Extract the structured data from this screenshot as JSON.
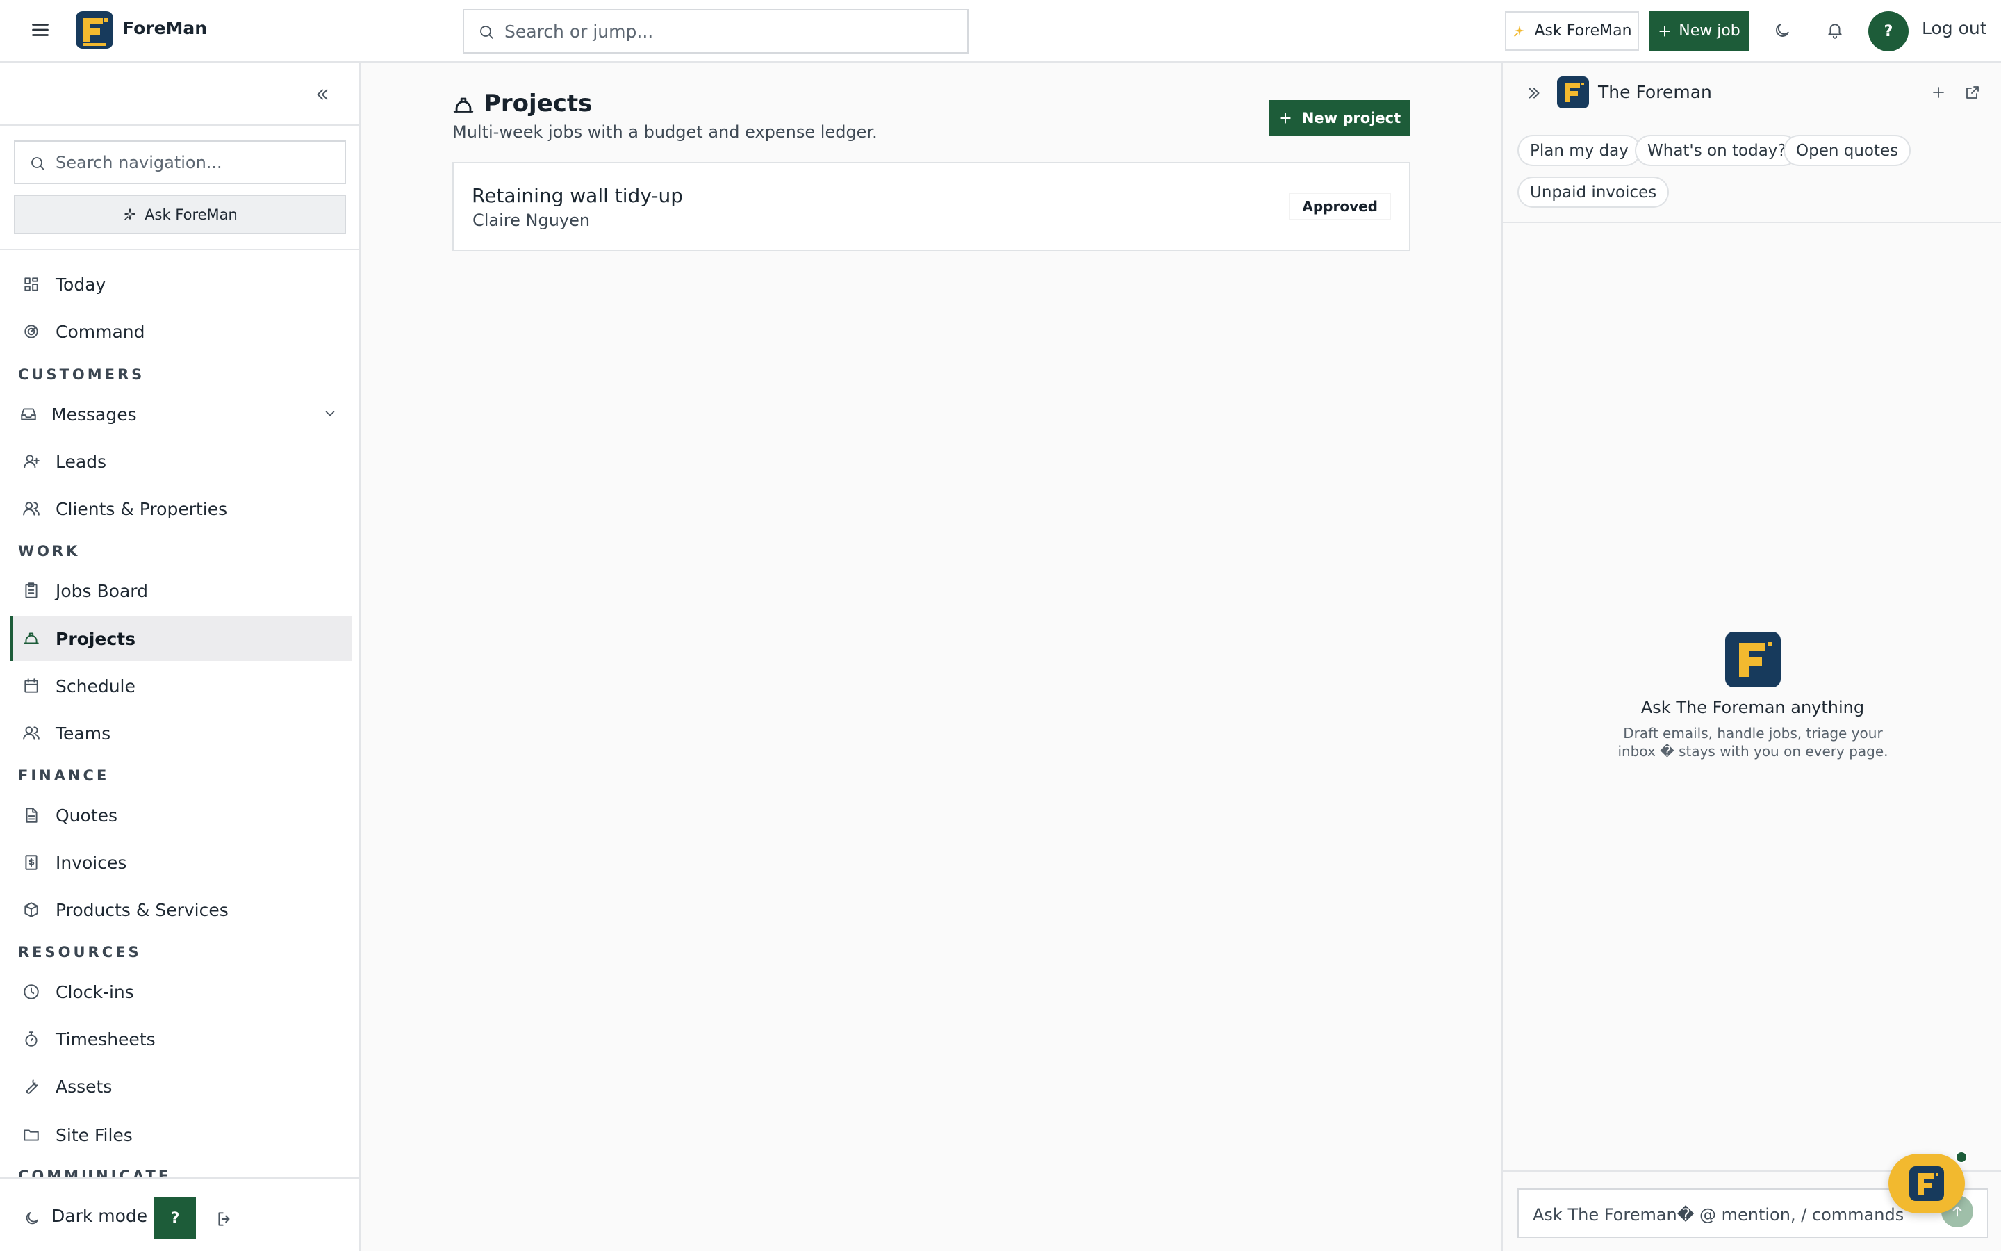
{
  "topbar": {
    "brand": "ForeMan",
    "search_placeholder": "Search or jump...",
    "ask_label": "Ask ForeMan",
    "new_job_label": "New job",
    "avatar_initial": "?",
    "logout_label": "Log out"
  },
  "sidebar": {
    "search_placeholder": "Search navigation...",
    "ask_label": "Ask ForeMan",
    "sections": {
      "customers": "CUSTOMERS",
      "work": "WORK",
      "finance": "FINANCE",
      "resources": "RESOURCES",
      "communicate": "COMMUNICATE"
    },
    "items": {
      "today": "Today",
      "command": "Command",
      "messages": "Messages",
      "leads": "Leads",
      "clients": "Clients & Properties",
      "jobs_board": "Jobs Board",
      "projects": "Projects",
      "schedule": "Schedule",
      "teams": "Teams",
      "quotes": "Quotes",
      "invoices": "Invoices",
      "products": "Products & Services",
      "clock_ins": "Clock-ins",
      "timesheets": "Timesheets",
      "assets": "Assets",
      "site_files": "Site Files"
    },
    "footer": {
      "dark_mode": "Dark mode",
      "help": "?"
    }
  },
  "main": {
    "title": "Projects",
    "subtitle": "Multi-week jobs with a budget and expense ledger.",
    "new_project_label": "New project",
    "projects": [
      {
        "name": "Retaining wall tidy-up",
        "client": "Claire Nguyen",
        "status": "Approved"
      }
    ]
  },
  "assistant": {
    "title": "The Foreman",
    "chips": [
      "Plan my day",
      "What's on today?",
      "Open quotes",
      "Unpaid invoices"
    ],
    "empty_title": "Ask The Foreman anything",
    "empty_desc": "Draft emails, handle jobs, triage your inbox � stays with you on every page.",
    "input_placeholder": "Ask The Foreman� @ mention, / commands"
  },
  "colors": {
    "brand_green": "#1d5c39",
    "logo_navy": "#173a5c",
    "logo_yellow": "#f2b92f"
  }
}
